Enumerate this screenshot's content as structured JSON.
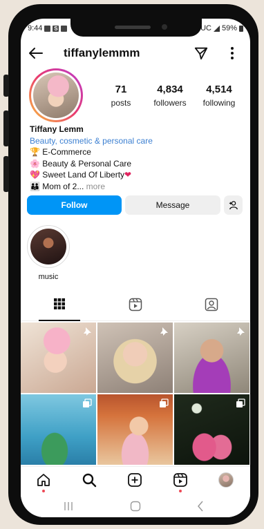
{
  "status": {
    "time": "9:44",
    "carrier_left": "S",
    "network": "UC",
    "battery": "59%"
  },
  "profile": {
    "username": "tiffanylemmm",
    "display_name": "Tiffany Lemm",
    "category": "Beauty, cosmetic & personal care",
    "bio_lines": [
      "E-Commerce",
      "Beauty & Personal Care",
      "Sweet Land Of Liberty"
    ],
    "bio_last": "Mom of 2...",
    "more_label": "more"
  },
  "stats": {
    "posts": {
      "value": "71",
      "label": "posts"
    },
    "followers": {
      "value": "4,834",
      "label": "followers"
    },
    "following": {
      "value": "4,514",
      "label": "following"
    }
  },
  "actions": {
    "follow": "Follow",
    "message": "Message"
  },
  "highlights": [
    {
      "label": "music"
    }
  ],
  "icons": {
    "back": "arrow-left-icon",
    "send": "paper-plane-icon",
    "more": "kebab-icon",
    "add_user": "person-add-icon",
    "grid": "grid-icon",
    "reels": "reels-icon",
    "tagged": "tagged-icon",
    "pin": "pin-icon",
    "carousel": "carousel-icon"
  },
  "colors": {
    "accent": "#0095f6",
    "category_link": "#3b7fd1",
    "notification": "#ed4956"
  }
}
